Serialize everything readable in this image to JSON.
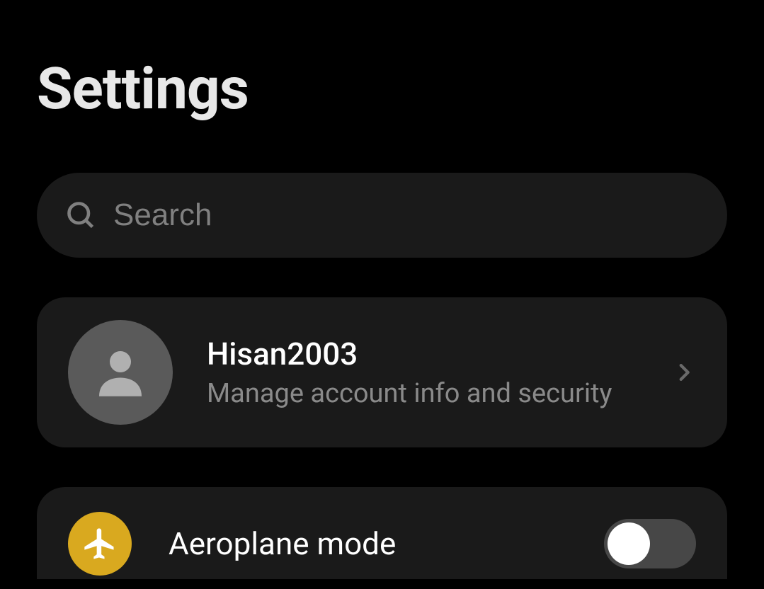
{
  "header": {
    "title": "Settings"
  },
  "search": {
    "placeholder": "Search"
  },
  "account": {
    "name": "Hisan2003",
    "subtitle": "Manage account info and security"
  },
  "settings": [
    {
      "label": "Aeroplane mode",
      "icon": "airplane",
      "icon_color": "#d9a91f",
      "toggled": false
    }
  ]
}
